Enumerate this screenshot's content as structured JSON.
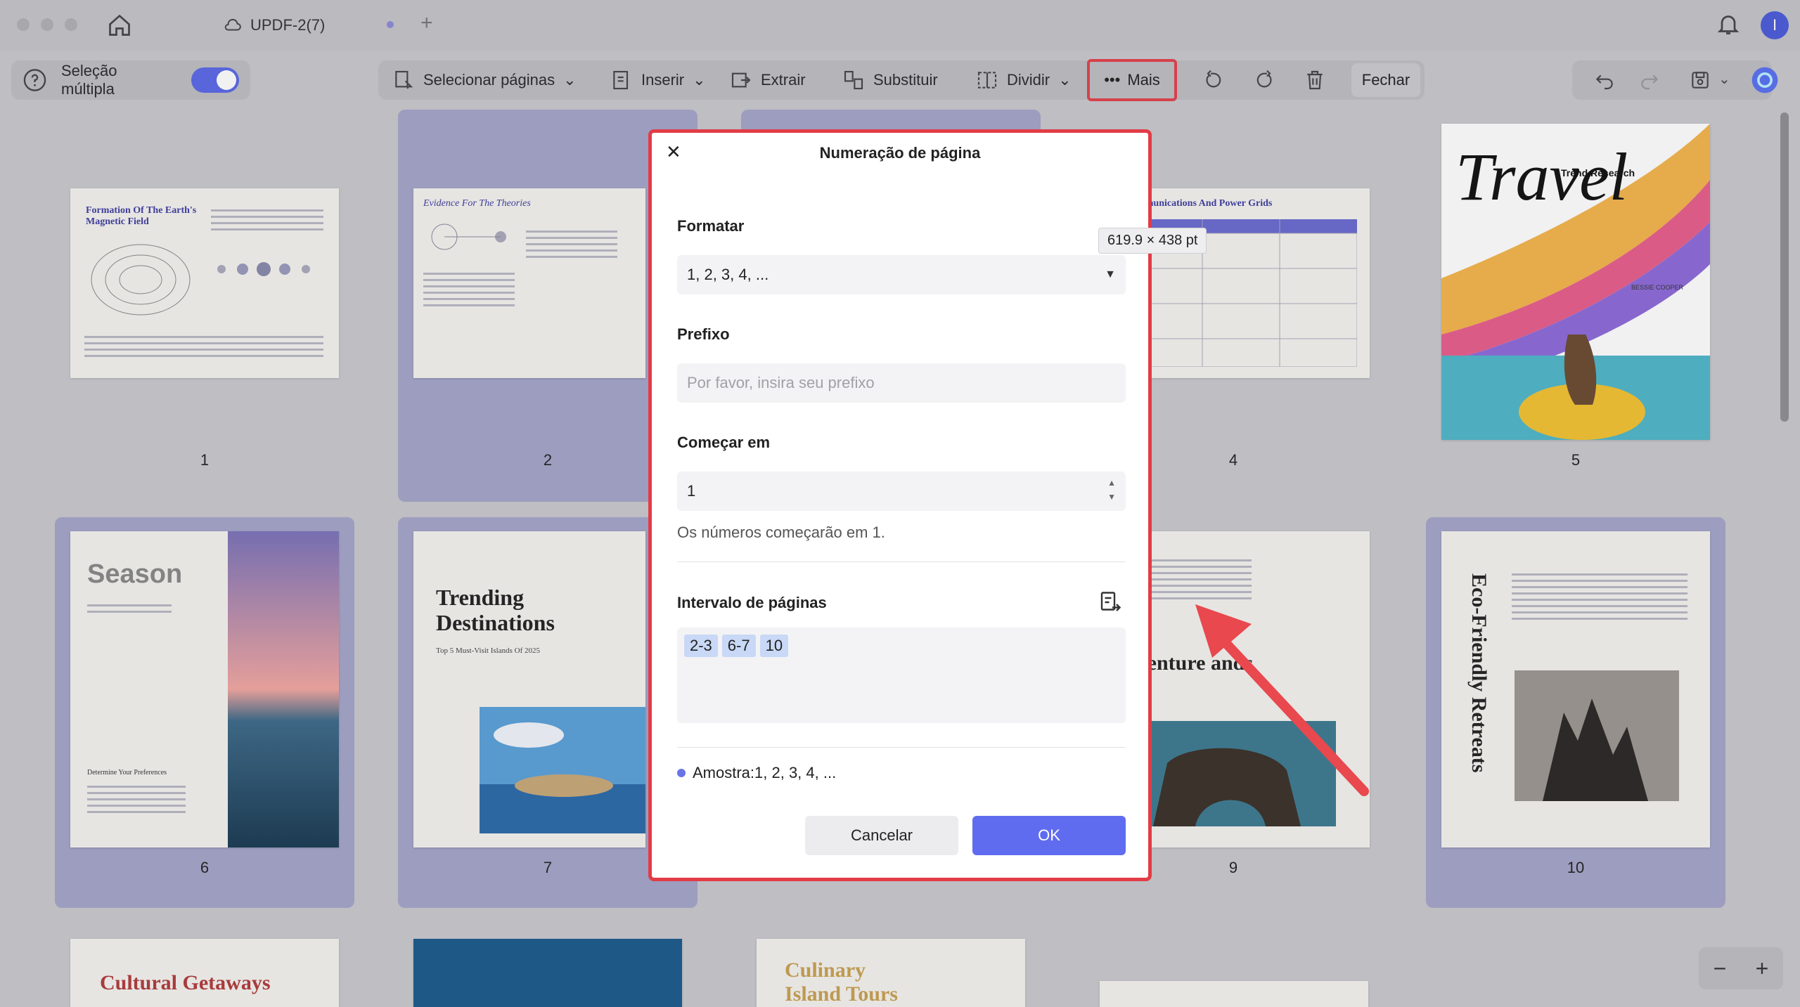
{
  "titlebar": {
    "tab_title": "UPDF-2(7)",
    "tab_add": "+",
    "avatar_letter": "I"
  },
  "toolbar": {
    "multi_select_label": "Seleção múltipla",
    "select_pages": "Selecionar páginas",
    "insert": "Inserir",
    "extract": "Extrair",
    "replace": "Substituir",
    "split": "Dividir",
    "more": "Mais",
    "close": "Fechar"
  },
  "pages": [
    {
      "num": "1",
      "title": "Formation Of The Earth's Magnetic Field"
    },
    {
      "num": "2",
      "title": "Evidence For The Theories"
    },
    {
      "num": "4",
      "title": "Communications And Power Grids"
    },
    {
      "num": "5",
      "title": "Travel",
      "subtitle": "Trend Research",
      "author": "BESSIE COOPER"
    },
    {
      "num": "6",
      "title": "Season",
      "subtitle": "Determine Your Preferences"
    },
    {
      "num": "7",
      "title": "Trending Destinations",
      "subtitle": "Top 5 Must-Visit Islands Of 2025"
    },
    {
      "num": "9",
      "title": "dventure ands"
    },
    {
      "num": "10",
      "title": "Eco-Friendly Retreats"
    }
  ],
  "bottom_row": [
    "Cultural Getaways",
    "Culinary Island Tours"
  ],
  "size_tooltip": "619.9 × 438 pt",
  "dialog": {
    "title": "Numeração de página",
    "format_label": "Formatar",
    "format_value": "1, 2, 3, 4, ...",
    "prefix_label": "Prefixo",
    "prefix_placeholder": "Por favor, insira seu prefixo",
    "start_label": "Começar em",
    "start_value": "1",
    "start_note": "Os números começarão em 1.",
    "range_label": "Intervalo de páginas",
    "range_chips": [
      "2-3",
      "6-7",
      "10"
    ],
    "sample": "Amostra:1, 2, 3, 4, ...",
    "cancel": "Cancelar",
    "ok": "OK"
  },
  "zoom": {
    "minus": "−",
    "plus": "+"
  },
  "colors": {
    "accent": "#5f6cf0",
    "highlight": "#e23c46",
    "selected_bg": "#a4a4c8"
  }
}
